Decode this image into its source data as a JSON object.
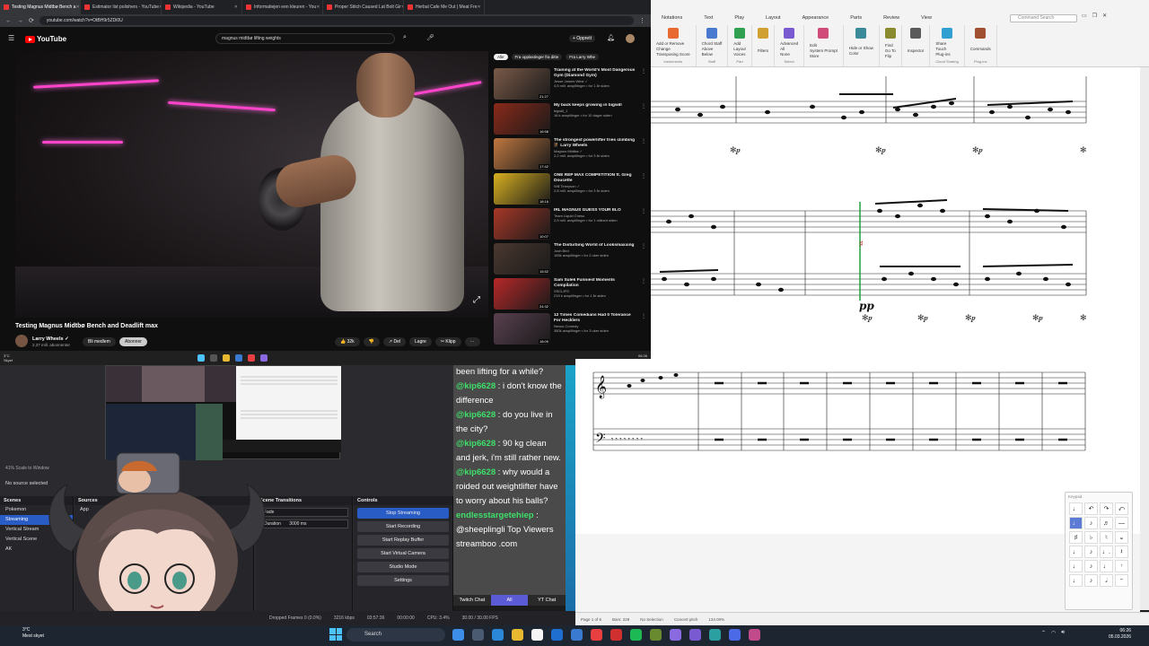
{
  "browser": {
    "tabs": [
      {
        "label": "Testing Magnus Midtbø Bench a",
        "active": true
      },
      {
        "label": "Estimator list polishers - YouTube",
        "active": false
      },
      {
        "label": "Wikipedia - YouTube",
        "active": false
      },
      {
        "label": "Informatiejen een kleuren - You",
        "active": false
      },
      {
        "label": "Proper Stitch Caused Lat Bolt Gir",
        "active": false
      },
      {
        "label": "Herbal Cafe Me Out | Meat Fre",
        "active": false
      }
    ],
    "url": "youtube.com/watch?v=OtBH9r5ZDi0U",
    "taskbar_clock": {
      "time": "06:26",
      "date": "05.03.2026"
    },
    "taskbar_weather": {
      "temp": "3°C",
      "desc": "Skyet"
    }
  },
  "youtube": {
    "logo": "YouTube",
    "search_query": "magnus midtbø lifting weights",
    "create_label": "+ Opprett",
    "video_title": "Testing Magnus Midtbø Bench and Deadlift max",
    "channel": {
      "name": "Larry Wheels ✓",
      "subs": "2,37 mill. abonnenter"
    },
    "members_label": "Bli medlem",
    "subscribe_label": "Abonner",
    "actions": [
      "👍 32k",
      "👎",
      "↗ Del",
      "Lagre",
      "✂ Klipp",
      "⋯"
    ],
    "chips": [
      {
        "label": "Alle",
        "on": true
      },
      {
        "label": "Fra opplastinger fra ditte",
        "on": false
      },
      {
        "label": "Fra Larry Whe",
        "on": false
      }
    ],
    "recommendations": [
      {
        "title": "Training at the World's Most Dangerous Gym (Diamond Gym)",
        "channel": "Jesse James West ✓",
        "stats": "4,6 mill. avspillinger • for 1 år siden",
        "duration": "21:27",
        "color": "#7a5a48"
      },
      {
        "title": "My back keeps growing in bigwill",
        "channel": "bigwill_1",
        "stats": "16 k avspillinger • for 10 dager siden",
        "duration": "16:58",
        "color": "#8a2a1a"
      },
      {
        "title": "The strongest powerlifter tries climbing 🧗 Larry Wheels",
        "channel": "Magnus Midtbø ✓",
        "stats": "2,2 mill. avspillinger • for 3 år siden",
        "duration": "17:42",
        "color": "#c07840"
      },
      {
        "title": "ONE REP MAX COMPETITION ft. Greg Doucette",
        "channel": "Will Tennyson ✓",
        "stats": "2,8 mill. avspillinger • for 3 år siden",
        "duration": "18:16",
        "color": "#d8b020"
      },
      {
        "title": "IRL MAGNUS GUESS YOUR ELO",
        "channel": "Team Liquid Chess",
        "stats": "2,5 mill. avspillinger • for 1 måned siden",
        "duration": "10:07",
        "color": "#a83828"
      },
      {
        "title": "The Disturbing World of Looksmaxxing",
        "channel": "Josh Bird",
        "stats": "165k avspillinger • for 2 uker siden",
        "duration": "15:52",
        "color": "#4a3830"
      },
      {
        "title": "Sam Sulek Funniest Moments Compilation",
        "channel": "SSCLIPS",
        "stats": "219 k avspillinger • for 1 år siden",
        "duration": "24:32",
        "color": "#b82828"
      },
      {
        "title": "12 Times Comedians Had 0 Tolerance For Hecklers",
        "channel": "Nexus Comedy",
        "stats": "380k avspillinger • for 3 uker siden",
        "duration": "18:09",
        "color": "#5a4050"
      }
    ]
  },
  "musescore": {
    "menu": [
      "Notations",
      "Text",
      "Play",
      "Layout",
      "Appearance",
      "Parts",
      "Review",
      "View"
    ],
    "command_search": "Command Search",
    "ribbon": [
      {
        "items": [
          "Add or Remove",
          "Change",
          "Transposing Score"
        ],
        "label": "Instruments"
      },
      {
        "items": [
          "Chord Staff",
          "Above",
          "Below"
        ],
        "label": "Staff"
      },
      {
        "items": [
          "Add",
          "Layout",
          "Voices"
        ],
        "label": "Part"
      },
      {
        "items": [
          "Filters"
        ],
        "label": ""
      },
      {
        "items": [
          "Advanced",
          "All",
          "None"
        ],
        "label": "Select"
      },
      {
        "items": [
          "Edit",
          "System Prompt",
          "More"
        ],
        "label": ""
      },
      {
        "items": [
          "Hide or Show",
          "Color"
        ],
        "label": ""
      },
      {
        "items": [
          "Find",
          "Go To",
          "Flip"
        ],
        "label": ""
      },
      {
        "items": [
          "Inspector"
        ],
        "label": ""
      },
      {
        "items": [
          "Share",
          "Touch",
          "Plug-ins"
        ],
        "label": "Cloud Sharing"
      },
      {
        "items": [
          "Commands"
        ],
        "label": "Plug-ins"
      }
    ],
    "dynamic": "pp",
    "status": [
      "Page 1 of 6",
      "Bars: 228",
      "No Selection",
      "Concert pitch",
      "134.00%"
    ],
    "keypad_title": "Keypad",
    "keypad_keys": [
      "♩",
      "↶",
      "↷",
      "⤺",
      "♩",
      "♪",
      "♬",
      "—",
      "♯",
      "♭",
      "♮",
      "𝄪",
      "♩",
      "♪",
      "♩.",
      "𝄽",
      "♩",
      "♪",
      "♩",
      "𝄾",
      "♩",
      "♪",
      "𝅗𝅥",
      "𝄻"
    ]
  },
  "obs": {
    "scale_label": "41%  Scale to Window",
    "no_source": "No source selected",
    "docks": {
      "scenes": "Scenes",
      "sources": "Sources",
      "transitions": "Scene Transitions",
      "controls": "Controls"
    },
    "scenes": [
      {
        "label": "Pokemon",
        "selected": false
      },
      {
        "label": "Streaming",
        "selected": true
      },
      {
        "label": "Vertical Stream",
        "selected": false
      },
      {
        "label": "Vertical Scene",
        "selected": false
      },
      {
        "label": "AK",
        "selected": false
      }
    ],
    "sources": [
      "App"
    ],
    "transition": {
      "type": "Fade",
      "duration_label": "Duration",
      "duration": "3000 ms"
    },
    "controls": [
      {
        "label": "Stop Streaming",
        "active": true
      },
      {
        "label": "Start Recording",
        "active": false
      },
      {
        "label": "Start Replay Buffer",
        "active": false
      },
      {
        "label": "Start Virtual Camera",
        "active": false
      },
      {
        "label": "Studio Mode",
        "active": false
      },
      {
        "label": "Settings",
        "active": false
      }
    ],
    "status": [
      "Dropped Frames 0 (0.0%)",
      "3216 kbps",
      "03:57:36",
      "00:00:00",
      "CPU: 3.4%",
      "30.00 / 30.00 FPS"
    ]
  },
  "chat": {
    "messages": [
      {
        "user": "",
        "text": "been lifting for a while?"
      },
      {
        "user": "@kip6628",
        "text": " : i don't know the difference"
      },
      {
        "user": "@kip6628",
        "text": " : do you live in the city?"
      },
      {
        "user": "@kip6628",
        "text": " : 90 kg clean and jerk, i'm still rather new."
      },
      {
        "user": "@kip6628",
        "text": " : why would a roided out weightlifter have to worry about his balls?"
      },
      {
        "user": "endlesstargetehiep",
        "text": " : @sheeplingli Top Viewers streamboo .com"
      }
    ],
    "tabs": [
      {
        "label": "Twitch Chat",
        "on": false
      },
      {
        "label": "All",
        "on": true
      },
      {
        "label": "YT Chat",
        "on": false
      }
    ]
  },
  "taskbar": {
    "weather": {
      "temp": "3°C",
      "desc": "Mest skyet"
    },
    "search": "Search",
    "clock": {
      "time": "06:26",
      "date": "05.03.2026"
    },
    "apps": [
      "#3c8ee8",
      "#4a5a70",
      "#2b88d8",
      "#e8b830",
      "#f5f5f5",
      "#1f6fd0",
      "#3a7ad0",
      "#e84040",
      "#d03030",
      "#1db954",
      "#6a8a30",
      "#8a6ae0",
      "#7a5ad0",
      "#2aa0a0",
      "#4a6ae8",
      "#c04a8a"
    ],
    "accent": "#4cc2ff"
  }
}
